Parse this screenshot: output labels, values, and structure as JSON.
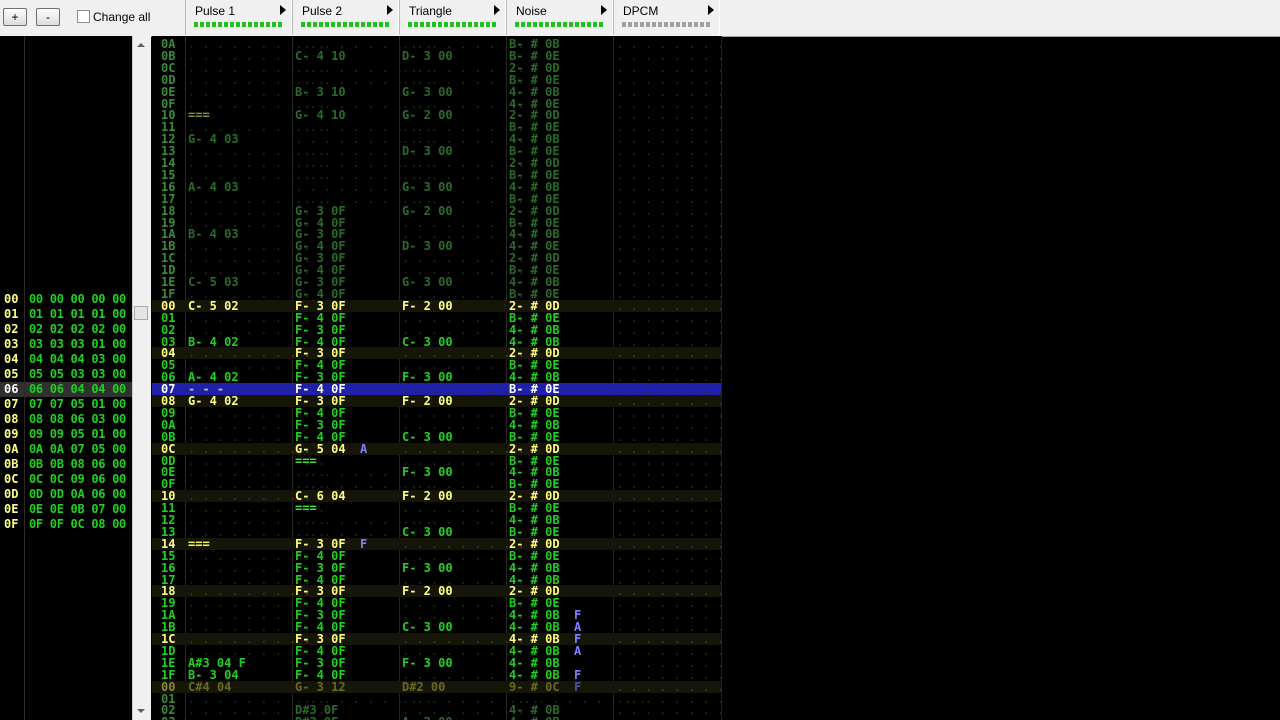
{
  "toolbar": {
    "add_label": "+",
    "remove_label": "-",
    "change_all_label": "Change all"
  },
  "channels": [
    {
      "name": "Pulse 1",
      "meter_color": "#20c020"
    },
    {
      "name": "Pulse 2",
      "meter_color": "#20c020"
    },
    {
      "name": "Triangle",
      "meter_color": "#20c020"
    },
    {
      "name": "Noise",
      "meter_color": "#20c020"
    },
    {
      "name": "DPCM",
      "meter_color": "#a0a0a0"
    }
  ],
  "frames": [
    {
      "num": "00",
      "vals": "00 00 00 00 00"
    },
    {
      "num": "01",
      "vals": "01 01 01 01 00"
    },
    {
      "num": "02",
      "vals": "02 02 02 02 00"
    },
    {
      "num": "03",
      "vals": "03 03 03 01 00"
    },
    {
      "num": "04",
      "vals": "04 04 04 03 00"
    },
    {
      "num": "05",
      "vals": "05 05 03 03 00"
    },
    {
      "num": "06",
      "vals": "06 06 04 04 00"
    },
    {
      "num": "07",
      "vals": "07 07 05 01 00"
    },
    {
      "num": "08",
      "vals": "08 08 06 03 00"
    },
    {
      "num": "09",
      "vals": "09 09 05 01 00"
    },
    {
      "num": "0A",
      "vals": "0A 0A 07 05 00"
    },
    {
      "num": "0B",
      "vals": "0B 0B 08 06 00"
    },
    {
      "num": "0C",
      "vals": "0C 0C 09 06 00"
    },
    {
      "num": "0D",
      "vals": "0D 0D 0A 06 00"
    },
    {
      "num": "0E",
      "vals": "0E 0E 0B 07 00"
    },
    {
      "num": "0F",
      "vals": "0F 0F 0C 08 00"
    }
  ],
  "selected_frame": 6,
  "pattern_rows": [
    {
      "n": "0A",
      "p1": "",
      "p2": "",
      "tri": "",
      "noi": "B- # 0B",
      "style": "prev"
    },
    {
      "n": "0B",
      "p1": "",
      "p2": "C- 4 10",
      "tri": "D- 3 00",
      "noi": "B- # 0E",
      "style": "prev"
    },
    {
      "n": "0C",
      "p1": "",
      "p2": "",
      "tri": "",
      "noi": "2- # 0D",
      "style": "prev"
    },
    {
      "n": "0D",
      "p1": "",
      "p2": "",
      "tri": "",
      "noi": "B- # 0E",
      "style": "prev"
    },
    {
      "n": "0E",
      "p1": "",
      "p2": "B- 3 10",
      "tri": "G- 3 00",
      "noi": "4- # 0B",
      "style": "prev"
    },
    {
      "n": "0F",
      "p1": "",
      "p2": "",
      "tri": "",
      "noi": "4- # 0E",
      "style": "prev"
    },
    {
      "n": "10",
      "p1": "===",
      "p2": "G- 4 10",
      "tri": "G- 2 00",
      "noi": "2- # 0D",
      "style": "prev"
    },
    {
      "n": "11",
      "p1": "",
      "p2": "",
      "tri": "",
      "noi": "B- # 0E",
      "style": "prev"
    },
    {
      "n": "12",
      "p1": "G- 4 03",
      "p2": "",
      "tri": "",
      "noi": "4- # 0B",
      "style": "prev"
    },
    {
      "n": "13",
      "p1": "",
      "p2": "",
      "tri": "D- 3 00",
      "noi": "B- # 0E",
      "style": "prev"
    },
    {
      "n": "14",
      "p1": "",
      "p2": "",
      "tri": "",
      "noi": "2- # 0D",
      "style": "prev"
    },
    {
      "n": "15",
      "p1": "",
      "p2": "",
      "tri": "",
      "noi": "B- # 0E",
      "style": "prev"
    },
    {
      "n": "16",
      "p1": "A- 4 03",
      "p2": "",
      "tri": "G- 3 00",
      "noi": "4- # 0B",
      "style": "prev"
    },
    {
      "n": "17",
      "p1": "",
      "p2": "",
      "tri": "",
      "noi": "B- # 0E",
      "style": "prev"
    },
    {
      "n": "18",
      "p1": "",
      "p2": "G- 3 0F",
      "tri": "G- 2 00",
      "noi": "2- # 0D",
      "style": "prev"
    },
    {
      "n": "19",
      "p1": "",
      "p2": "G- 4 0F",
      "tri": "",
      "noi": "B- # 0E",
      "style": "prev"
    },
    {
      "n": "1A",
      "p1": "B- 4 03",
      "p2": "G- 3 0F",
      "tri": "",
      "noi": "4- # 0B",
      "style": "prev"
    },
    {
      "n": "1B",
      "p1": "",
      "p2": "G- 4 0F",
      "tri": "D- 3 00",
      "noi": "4- # 0E",
      "style": "prev"
    },
    {
      "n": "1C",
      "p1": "",
      "p2": "G- 3 0F",
      "tri": "",
      "noi": "2- # 0D",
      "style": "prev"
    },
    {
      "n": "1D",
      "p1": "",
      "p2": "G- 4 0F",
      "tri": "",
      "noi": "B- # 0E",
      "style": "prev"
    },
    {
      "n": "1E",
      "p1": "C- 5 03",
      "p2": "G- 3 0F",
      "tri": "G- 3 00",
      "noi": "4- # 0B",
      "style": "prev"
    },
    {
      "n": "1F",
      "p1": "",
      "p2": "G- 4 0F",
      "tri": "",
      "noi": "B- # 0E",
      "style": "prev"
    },
    {
      "n": "00",
      "p1": "C- 5 02",
      "p2": "F- 3 0F",
      "tri": "F- 2 00",
      "noi": "2- # 0D",
      "style": "beat"
    },
    {
      "n": "01",
      "p1": "",
      "p2": "F- 4 0F",
      "tri": "",
      "noi": "B- # 0E",
      "style": "cur"
    },
    {
      "n": "02",
      "p1": "",
      "p2": "F- 3 0F",
      "tri": "",
      "noi": "4- # 0B",
      "style": "cur"
    },
    {
      "n": "03",
      "p1": "B- 4 02",
      "p2": "F- 4 0F",
      "tri": "C- 3 00",
      "noi": "4- # 0B",
      "style": "cur"
    },
    {
      "n": "04",
      "p1": "",
      "p2": "F- 3 0F",
      "tri": "",
      "noi": "2- # 0D",
      "style": "beat"
    },
    {
      "n": "05",
      "p1": "",
      "p2": "F- 4 0F",
      "tri": "",
      "noi": "B- # 0E",
      "style": "cur"
    },
    {
      "n": "06",
      "p1": "A- 4 02",
      "p2": "F- 3 0F",
      "tri": "F- 3 00",
      "noi": "4- # 0B",
      "style": "cur"
    },
    {
      "n": "07",
      "p1": "- - -",
      "p2": "F- 4 0F",
      "tri": "",
      "noi": "B- # 0E",
      "style": "cursor"
    },
    {
      "n": "08",
      "p1": "G- 4 02",
      "p2": "F- 3 0F",
      "tri": "F- 2 00",
      "noi": "2- # 0D",
      "style": "beat"
    },
    {
      "n": "09",
      "p1": "",
      "p2": "F- 4 0F",
      "tri": "",
      "noi": "B- # 0E",
      "style": "cur"
    },
    {
      "n": "0A",
      "p1": "",
      "p2": "F- 3 0F",
      "tri": "",
      "noi": "4- # 0B",
      "style": "cur"
    },
    {
      "n": "0B",
      "p1": "",
      "p2": "F- 4 0F",
      "tri": "C- 3 00",
      "noi": "B- # 0E",
      "style": "cur"
    },
    {
      "n": "0C",
      "p1": "",
      "p2": "G- 5 04 A",
      "tri": "",
      "noi": "2- # 0D",
      "style": "beat"
    },
    {
      "n": "0D",
      "p1": "",
      "p2": "===",
      "tri": "",
      "noi": "B- # 0E",
      "style": "cur"
    },
    {
      "n": "0E",
      "p1": "",
      "p2": "",
      "tri": "F- 3 00",
      "noi": "4- # 0B",
      "style": "cur"
    },
    {
      "n": "0F",
      "p1": "",
      "p2": "",
      "tri": "",
      "noi": "B- # 0E",
      "style": "cur"
    },
    {
      "n": "10",
      "p1": "",
      "p2": "C- 6 04",
      "tri": "F- 2 00",
      "noi": "2- # 0D",
      "style": "beat"
    },
    {
      "n": "11",
      "p1": "",
      "p2": "===",
      "tri": "",
      "noi": "B- # 0E",
      "style": "cur"
    },
    {
      "n": "12",
      "p1": "",
      "p2": "",
      "tri": "",
      "noi": "4- # 0B",
      "style": "cur"
    },
    {
      "n": "13",
      "p1": "",
      "p2": "",
      "tri": "C- 3 00",
      "noi": "B- # 0E",
      "style": "cur"
    },
    {
      "n": "14",
      "p1": "===",
      "p2": "F- 3 0F F",
      "tri": "",
      "noi": "2- # 0D",
      "style": "beat"
    },
    {
      "n": "15",
      "p1": "",
      "p2": "F- 4 0F",
      "tri": "",
      "noi": "B- # 0E",
      "style": "cur"
    },
    {
      "n": "16",
      "p1": "",
      "p2": "F- 3 0F",
      "tri": "F- 3 00",
      "noi": "4- # 0B",
      "style": "cur"
    },
    {
      "n": "17",
      "p1": "",
      "p2": "F- 4 0F",
      "tri": "",
      "noi": "4- # 0B",
      "style": "cur"
    },
    {
      "n": "18",
      "p1": "",
      "p2": "F- 3 0F",
      "tri": "F- 2 00",
      "noi": "2- # 0D",
      "style": "beat"
    },
    {
      "n": "19",
      "p1": "",
      "p2": "F- 4 0F",
      "tri": "",
      "noi": "B- # 0E",
      "style": "cur"
    },
    {
      "n": "1A",
      "p1": "",
      "p2": "F- 3 0F",
      "tri": "",
      "noi": "4- # 0B F",
      "style": "cur"
    },
    {
      "n": "1B",
      "p1": "",
      "p2": "F- 4 0F",
      "tri": "C- 3 00",
      "noi": "4- # 0B A",
      "style": "cur"
    },
    {
      "n": "1C",
      "p1": "",
      "p2": "F- 3 0F",
      "tri": "",
      "noi": "4- # 0B F",
      "style": "beat"
    },
    {
      "n": "1D",
      "p1": "",
      "p2": "F- 4 0F",
      "tri": "",
      "noi": "4- # 0B A",
      "style": "cur"
    },
    {
      "n": "1E",
      "p1": "A#3 04 F",
      "p2": "F- 3 0F",
      "tri": "F- 3 00",
      "noi": "4- # 0B",
      "style": "cur"
    },
    {
      "n": "1F",
      "p1": "B- 3 04",
      "p2": "F- 4 0F",
      "tri": "",
      "noi": "4- # 0B F",
      "style": "cur"
    },
    {
      "n": "00",
      "p1": "C#4 04",
      "p2": "G- 3 12",
      "tri": "D#2 00",
      "noi": "9- # 0C F",
      "style": "nextbeat"
    },
    {
      "n": "01",
      "p1": "",
      "p2": "",
      "tri": "",
      "noi": "",
      "style": "next"
    },
    {
      "n": "02",
      "p1": "",
      "p2": "D#3 0F",
      "tri": "",
      "noi": "4- # 0B",
      "style": "next"
    },
    {
      "n": "03",
      "p1": "",
      "p2": "D#3 0F",
      "tri": "A- 2 00",
      "noi": "4- # 0B",
      "style": "next"
    }
  ],
  "colors": {
    "note": "#20d020",
    "note_dim": "#2a6a2a",
    "beat_num": "#ffff80",
    "row_num": "#20d020",
    "effect": "#8080ff",
    "cursor_bg": "#2020a8"
  }
}
